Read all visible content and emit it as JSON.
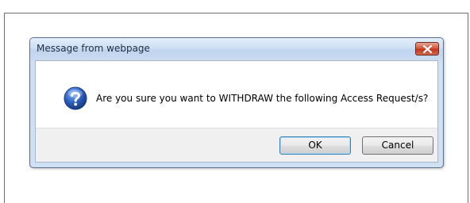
{
  "dialog": {
    "title": "Message from webpage",
    "message": "Are you sure you want to WITHDRAW the following Access Request/s?",
    "icon": "question-icon",
    "ok_label": "OK",
    "cancel_label": "Cancel",
    "close_icon": "close-icon"
  },
  "colors": {
    "close_button": "#d6583e",
    "titlebar": "#cddff3",
    "question_icon": "#2a5bb8"
  }
}
